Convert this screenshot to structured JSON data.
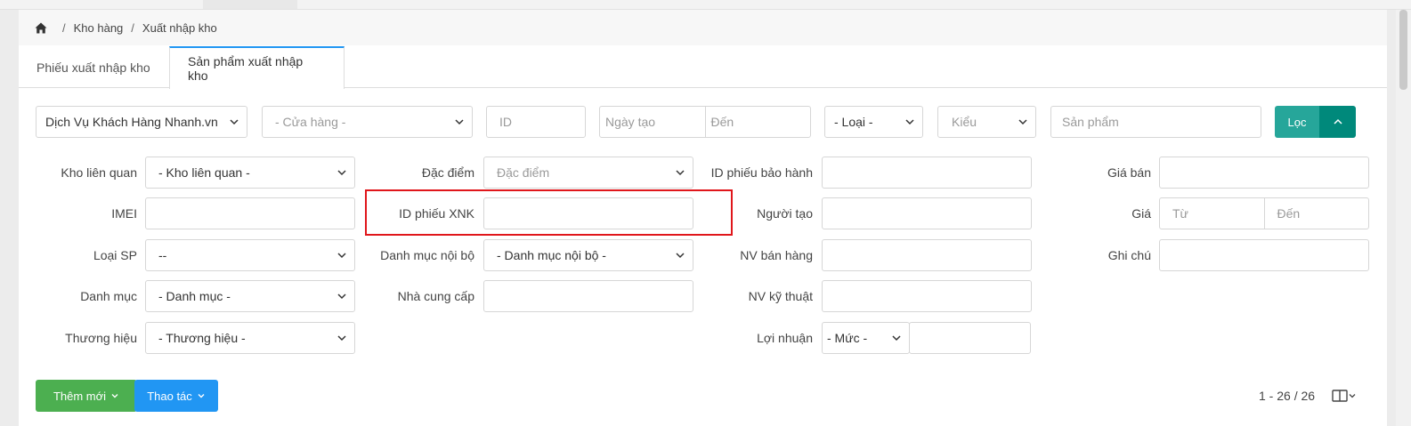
{
  "breadcrumb": {
    "home_icon": "home-icon",
    "items": [
      "Kho hàng",
      "Xuất nhập kho"
    ],
    "separator": "/"
  },
  "tabs": [
    {
      "label": "Phiếu xuất nhập kho",
      "active": false
    },
    {
      "label": "Sản phẩm xuất nhập kho",
      "active": true
    }
  ],
  "filters_top": {
    "store_group": "Dịch Vụ Khách Hàng Nhanh.vn",
    "store": "- Cửa hàng -",
    "id": "ID",
    "date_from": "Ngày tạo",
    "date_to": "Đến",
    "type": "- Loại -",
    "kind": "Kiểu",
    "product": "Sản phẩm",
    "filter_button": "Lọc",
    "collapse_icon": "chevron-up-icon"
  },
  "filters": {
    "related_warehouse": {
      "label": "Kho liên quan",
      "value": "- Kho liên quan -"
    },
    "imei": {
      "label": "IMEI",
      "value": ""
    },
    "product_type": {
      "label": "Loại SP",
      "value": "--"
    },
    "category": {
      "label": "Danh mục",
      "value": "- Danh mục -"
    },
    "brand": {
      "label": "Thương hiệu",
      "value": "- Thương hiệu -"
    },
    "feature": {
      "label": "Đặc điểm",
      "placeholder": "Đặc điểm"
    },
    "xnk_id": {
      "label": "ID phiếu XNK",
      "value": ""
    },
    "internal_category": {
      "label": "Danh mục nội bộ",
      "value": "- Danh mục nội bộ -"
    },
    "supplier": {
      "label": "Nhà cung cấp",
      "value": ""
    },
    "warranty_id": {
      "label": "ID phiếu bảo hành",
      "value": ""
    },
    "creator": {
      "label": "Người tạo",
      "value": ""
    },
    "sales_staff": {
      "label": "NV bán hàng",
      "value": ""
    },
    "tech_staff": {
      "label": "NV kỹ thuật",
      "value": ""
    },
    "profit": {
      "label": "Lợi nhuận",
      "level": "- Mức -",
      "value": ""
    },
    "sale_price": {
      "label": "Giá bán",
      "value": ""
    },
    "price": {
      "label": "Giá",
      "from": "Từ",
      "to": "Đến"
    },
    "note": {
      "label": "Ghi chú",
      "value": ""
    }
  },
  "actions": {
    "add_new": "Thêm mới",
    "operations": "Thao tác"
  },
  "pagination": {
    "range": "1 - 26 / 26"
  },
  "colors": {
    "accent_blue": "#2196f3",
    "teal": "#26a69a",
    "teal_dark": "#00897b",
    "green": "#4caf50",
    "highlight_red": "#e0161b"
  }
}
